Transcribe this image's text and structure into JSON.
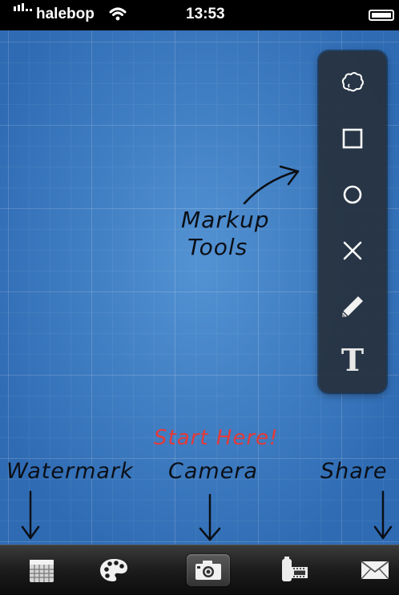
{
  "status_bar": {
    "carrier": "halebop",
    "time": "13:53",
    "icons": [
      "signal-icon",
      "wifi-icon",
      "battery-icon"
    ]
  },
  "canvas": {
    "annotations": {
      "markup_line1": "Markup",
      "markup_line2": "Tools",
      "start_here": "Start Here!",
      "watermark": "Watermark",
      "camera": "Camera",
      "share": "Share"
    },
    "colors": {
      "blueprint": "#3d7fc3",
      "start_here": "#e23a3a",
      "ink": "#0b0f16"
    }
  },
  "tool_palette": {
    "tools": [
      {
        "name": "cloud-tool",
        "icon": "cloud-icon"
      },
      {
        "name": "rectangle-tool",
        "icon": "square-icon"
      },
      {
        "name": "circle-tool",
        "icon": "circle-icon"
      },
      {
        "name": "x-mark-tool",
        "icon": "x-icon"
      },
      {
        "name": "pencil-tool",
        "icon": "pencil-icon"
      },
      {
        "name": "text-tool",
        "icon": "text-icon",
        "glyph": "T"
      }
    ]
  },
  "tab_bar": {
    "tabs": [
      {
        "name": "watermark-tab",
        "icon": "calendar-icon"
      },
      {
        "name": "palette-tab",
        "icon": "palette-icon"
      },
      {
        "name": "camera-tab",
        "icon": "camera-icon",
        "active": true
      },
      {
        "name": "film-tab",
        "icon": "film-roll-icon"
      },
      {
        "name": "share-tab",
        "icon": "mail-icon"
      }
    ]
  }
}
